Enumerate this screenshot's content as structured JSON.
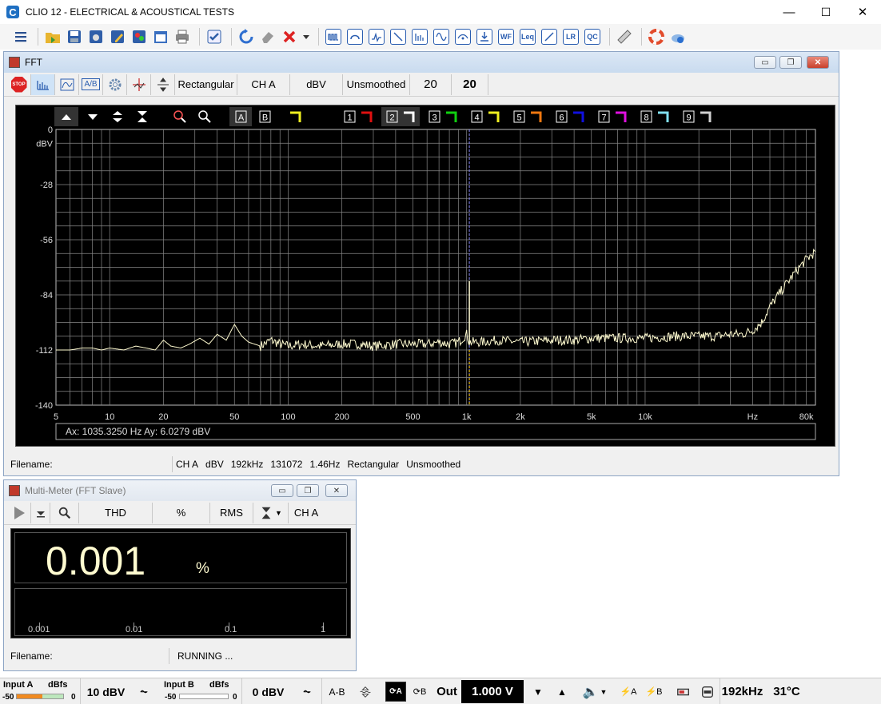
{
  "app": {
    "title": "CLIO 12 - ELECTRICAL & ACOUSTICAL TESTS",
    "logo_letter": "C"
  },
  "window_controls": {
    "minimize": "—",
    "maximize": "☐",
    "close": "✕"
  },
  "toolbar": {
    "icons": [
      "menu-icon",
      "open-folder-icon",
      "save-icon",
      "settings-save-icon",
      "edit-icon",
      "palette-icon",
      "calendar-icon",
      "print-icon",
      "checklist-icon",
      "refresh-icon",
      "eraser-icon",
      "delete-icon",
      "dropdown-icon",
      "mls-icon",
      "sinusoidal-icon",
      "fft-icon",
      "sweep-icon",
      "waterfall-icon",
      "sine-icon",
      "tone-icon",
      "level-icon",
      "wf-icon",
      "leq-icon",
      "curve-icon",
      "lr-icon",
      "qc-icon",
      "ruler-icon",
      "help-icon",
      "cloud-icon"
    ],
    "text_icons": {
      "wf": "WF",
      "leq": "Leq",
      "lr": "LR",
      "qc": "QC"
    }
  },
  "fft_window": {
    "title": "FFT",
    "stop_label": "STOP",
    "toolbar": {
      "window_type": "Rectangular",
      "channel": "CH A",
      "units": "dBV",
      "smoothing": "Unsmoothed",
      "averages": "20",
      "averages_done": "20",
      "ab_label": "A/B"
    },
    "plot_toolbar": {
      "a_label": "A",
      "b_label": "B",
      "overlays": [
        {
          "n": "1",
          "color": "#e01010"
        },
        {
          "n": "2",
          "color": "#ffffff"
        },
        {
          "n": "3",
          "color": "#10d010"
        },
        {
          "n": "4",
          "color": "#f0f020"
        },
        {
          "n": "5",
          "color": "#f07810"
        },
        {
          "n": "6",
          "color": "#1010e0"
        },
        {
          "n": "7",
          "color": "#e010e0"
        },
        {
          "n": "8",
          "color": "#80e0f0"
        },
        {
          "n": "9",
          "color": "#d0d0d0"
        }
      ]
    },
    "chart_data": {
      "type": "line",
      "x_scale": "log",
      "xlim": [
        5,
        90000
      ],
      "ylim": [
        -140,
        0
      ],
      "y_unit_label": "dBV",
      "x_unit_label": "Hz",
      "y_ticks": [
        "0",
        "-28",
        "-56",
        "-84",
        "-112",
        "-140"
      ],
      "x_ticks": [
        {
          "v": 5,
          "l": "5"
        },
        {
          "v": 10,
          "l": "10"
        },
        {
          "v": 20,
          "l": "20"
        },
        {
          "v": 50,
          "l": "50"
        },
        {
          "v": 100,
          "l": "100"
        },
        {
          "v": 200,
          "l": "200"
        },
        {
          "v": 500,
          "l": "500"
        },
        {
          "v": 1000,
          "l": "1k"
        },
        {
          "v": 2000,
          "l": "2k"
        },
        {
          "v": 5000,
          "l": "5k"
        },
        {
          "v": 10000,
          "l": "10k"
        },
        {
          "v": 40000,
          "l": "Hz"
        },
        {
          "v": 80000,
          "l": "80k"
        }
      ],
      "series": [
        {
          "color": "#fffbd0",
          "x": [
            5,
            6,
            7,
            8,
            9,
            10,
            12,
            14,
            16,
            18,
            20,
            22,
            25,
            28,
            32,
            36,
            40,
            45,
            50,
            55,
            60,
            70,
            80,
            90,
            100,
            120,
            150,
            200,
            250,
            300,
            400,
            500,
            600,
            700,
            800,
            900,
            1000,
            1035,
            1100,
            1200,
            1500,
            2000,
            3000,
            4000,
            5000,
            7000,
            10000,
            15000,
            20000,
            25000,
            30000,
            35000,
            40000,
            45000,
            50000,
            60000,
            70000,
            80000,
            90000
          ],
          "y": [
            -112,
            -112,
            -111,
            -111,
            -112,
            -111,
            -112,
            -110,
            -111,
            -112,
            -107,
            -110,
            -111,
            -109,
            -106,
            -109,
            -104,
            -107,
            -99,
            -105,
            -108,
            -110,
            -107,
            -109,
            -110,
            -109,
            -110,
            -109,
            -109,
            -110,
            -109,
            -109,
            -109,
            -108,
            -109,
            -108,
            -104,
            -108,
            -108,
            -108,
            -107,
            -108,
            -107,
            -107,
            -106,
            -106,
            -106,
            -105,
            -105,
            -105,
            -104,
            -104,
            -102,
            -98,
            -90,
            -80,
            -72,
            -66,
            -62
          ]
        }
      ],
      "cursor": {
        "x": 1035.325,
        "peak_y": 6.0279,
        "color": "#8888ff"
      },
      "cursor_readout": "Ax: 1035.3250 Hz   Ay: 6.0279 dBV"
    },
    "status": {
      "filename_label": "Filename:",
      "info": [
        "CH A",
        "dBV",
        "192kHz",
        "131072",
        "1.46Hz",
        "Rectangular",
        "Unsmoothed"
      ]
    }
  },
  "multimeter_window": {
    "title": "Multi-Meter (FFT Slave)",
    "toolbar": {
      "measure": "THD",
      "unit": "%",
      "mode": "RMS",
      "channel": "CH A"
    },
    "reading": {
      "value": "0.001",
      "unit": "%"
    },
    "bar_fill_fraction": 0.0,
    "scale_labels": [
      "0.001",
      "0.01",
      "0.1",
      "1"
    ],
    "status": {
      "filename_label": "Filename:",
      "state": "RUNNING ..."
    }
  },
  "bottombar": {
    "input_a": {
      "label": "Input A",
      "unit": "dBfs",
      "min": "-50",
      "max": "0",
      "level_fraction": 0.55
    },
    "range_a": "10 dBV",
    "input_b": {
      "label": "Input B",
      "unit": "dBfs",
      "min": "-50",
      "max": "0",
      "level_fraction": 0.0
    },
    "range_b": "0 dBV",
    "ab_label": "A-B",
    "loop_a": "A",
    "loop_b": "B",
    "out_label": "Out",
    "out_value": "1.000 V",
    "phantom_a": "A",
    "phantom_b": "B",
    "sample_rate": "192kHz",
    "temperature": "31°C"
  }
}
